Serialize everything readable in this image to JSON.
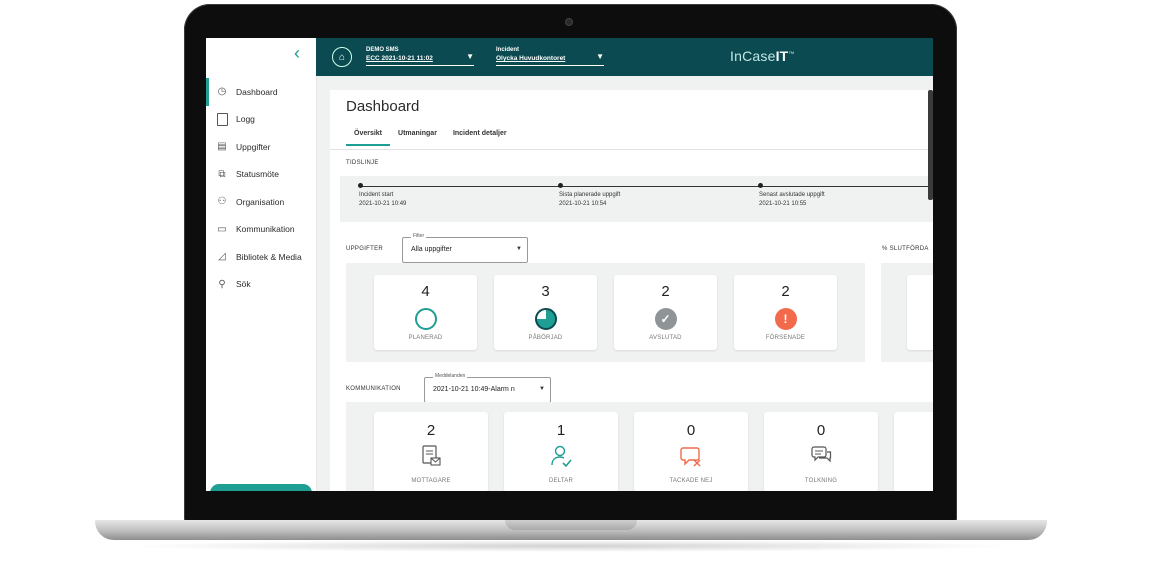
{
  "sidebar": {
    "items": [
      {
        "label": "Dashboard",
        "icon": "clock-icon",
        "active": true
      },
      {
        "label": "Logg",
        "icon": "log-icon"
      },
      {
        "label": "Uppgifter",
        "icon": "tasks-icon"
      },
      {
        "label": "Statusmöte",
        "icon": "meeting-icon"
      },
      {
        "label": "Organisation",
        "icon": "organisation-icon"
      },
      {
        "label": "Kommunikation",
        "icon": "communication-icon"
      },
      {
        "label": "Bibliotek & Media",
        "icon": "library-icon"
      },
      {
        "label": "Sök",
        "icon": "search-icon"
      }
    ]
  },
  "topbar": {
    "selector1": {
      "label": "DEMO SMS",
      "value": "ECC 2021-10-21 11:02"
    },
    "selector2": {
      "label": "Incident",
      "value": "Olycka Huvudkontoret"
    },
    "brand_prefix": "InCase",
    "brand_suffix": "IT",
    "brand_tm": "™"
  },
  "page": {
    "title": "Dashboard",
    "tabs": [
      {
        "label": "Översikt",
        "active": true
      },
      {
        "label": "Utmaningar"
      },
      {
        "label": "Incident detaljer"
      }
    ]
  },
  "timeline": {
    "label": "TIDSLINJE",
    "events": [
      {
        "title": "Incident start",
        "time": "2021-10-21 10:49"
      },
      {
        "title": "Sista planerade uppgift",
        "time": "2021-10-21 10:54"
      },
      {
        "title": "Senast avslutade uppgift",
        "time": "2021-10-21 10:55"
      }
    ]
  },
  "tasks": {
    "label": "UPPGIFTER",
    "filter_legend": "Filter",
    "filter_value": "Alla uppgifter",
    "percent_label": "% SLUTFÖRDA",
    "cards": [
      {
        "count": "4",
        "label": "PLANERAD",
        "icon": "planned-circle-icon",
        "color": "#1f9e93"
      },
      {
        "count": "3",
        "label": "PÅBÖRJAD",
        "icon": "in-progress-icon",
        "color": "#1f9e93"
      },
      {
        "count": "2",
        "label": "AVSLUTAD",
        "icon": "check-icon",
        "color": "#8f9597"
      },
      {
        "count": "2",
        "label": "FÖRSENADE",
        "icon": "alert-icon",
        "color": "#f26a4b"
      }
    ]
  },
  "communication": {
    "label": "KOMMUNIKATION",
    "filter_legend": "Meddelanden",
    "filter_value": "2021-10-21 10:49-Alarm n",
    "cards": [
      {
        "count": "2",
        "label": "MOTTAGARE",
        "icon": "recipients-icon"
      },
      {
        "count": "1",
        "label": "DELTAR",
        "icon": "participating-user-icon"
      },
      {
        "count": "0",
        "label": "TACKADE NEJ",
        "icon": "declined-chat-icon"
      },
      {
        "count": "0",
        "label": "TOLKNING",
        "icon": "interpretation-chat-icon"
      }
    ]
  }
}
